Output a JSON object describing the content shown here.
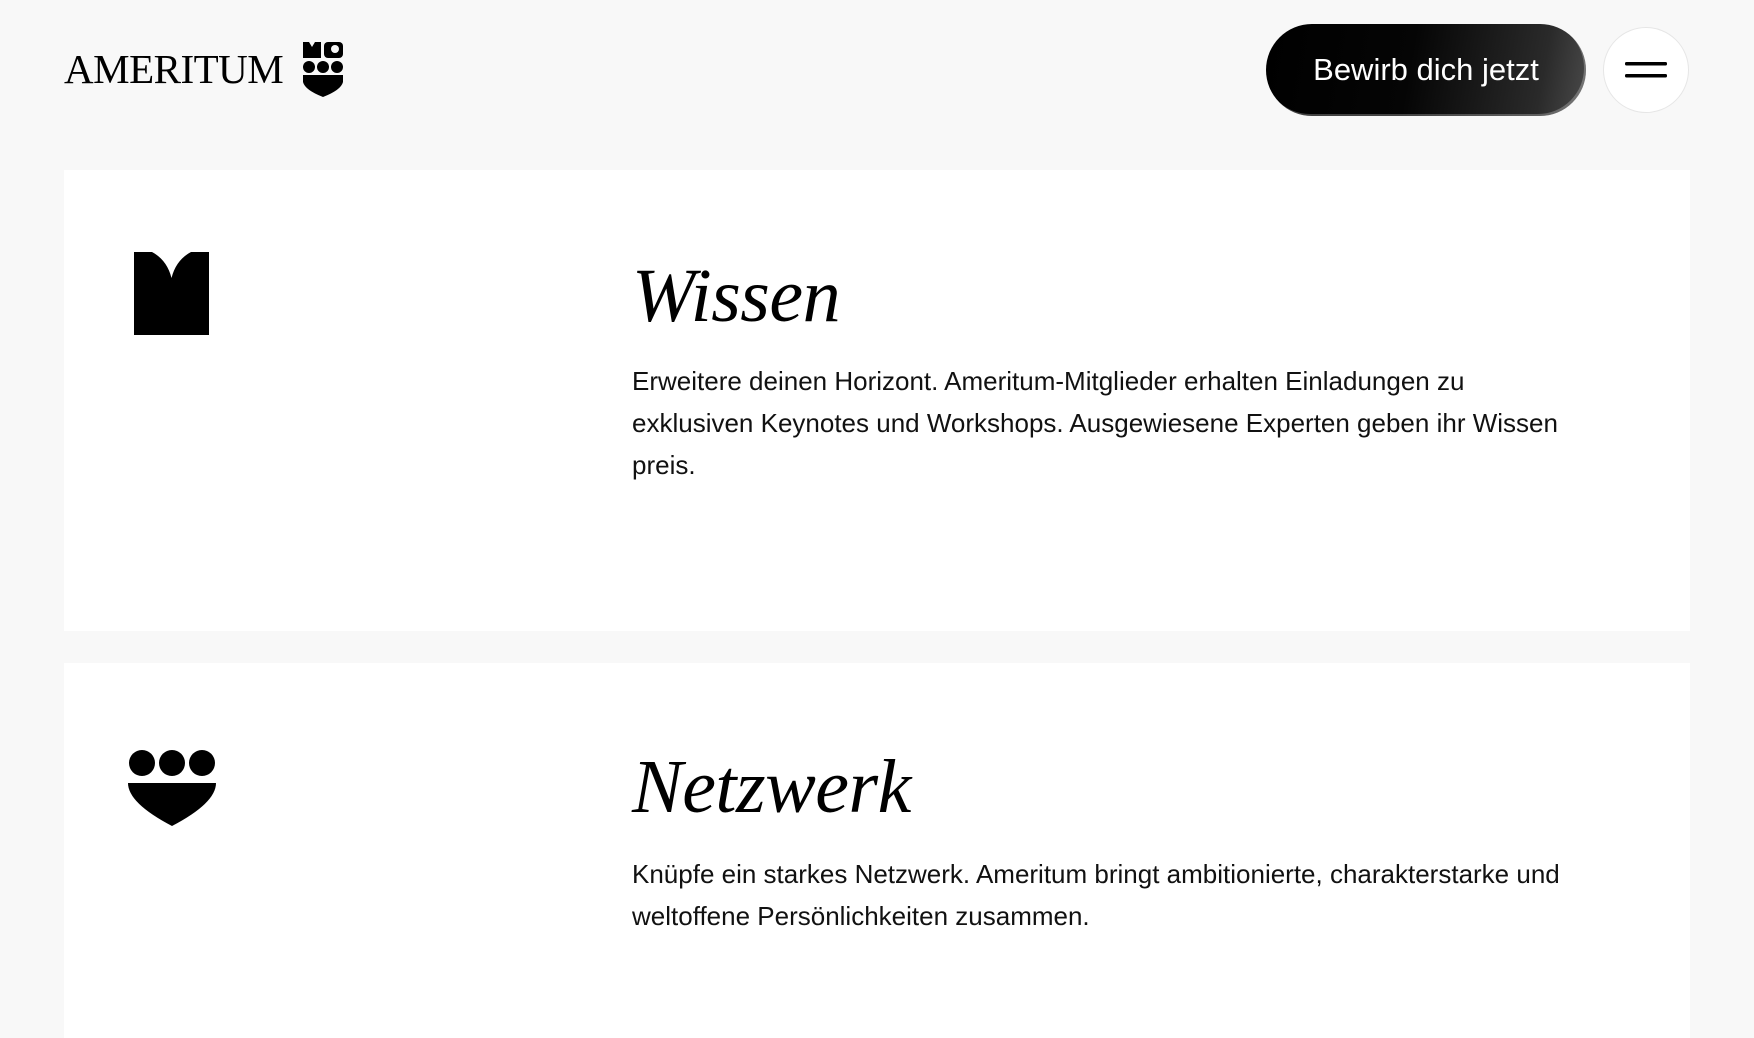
{
  "header": {
    "logo_text": "AMERITUM",
    "apply_button": "Bewirb dich jetzt",
    "menu_icon": "hamburger-menu-icon"
  },
  "features": [
    {
      "icon": "book-shape-icon",
      "title": "Wissen",
      "text": "Erweitere deinen Horizont. Ameritum-Mitglieder erhalten Einladungen zu exklusiven Keynotes und Workshops. Ausgewiesene Experten geben ihr Wissen preis."
    },
    {
      "icon": "three-dots-heart-icon",
      "title": "Netzwerk",
      "text": "Knüpfe ein starkes Netzwerk. Ameritum bringt ambitionierte, charakterstarke und weltoffene Persönlichkeiten zusammen."
    }
  ],
  "colors": {
    "background": "#f8f8f8",
    "card": "#ffffff",
    "text": "#000000",
    "button": "#000000"
  }
}
